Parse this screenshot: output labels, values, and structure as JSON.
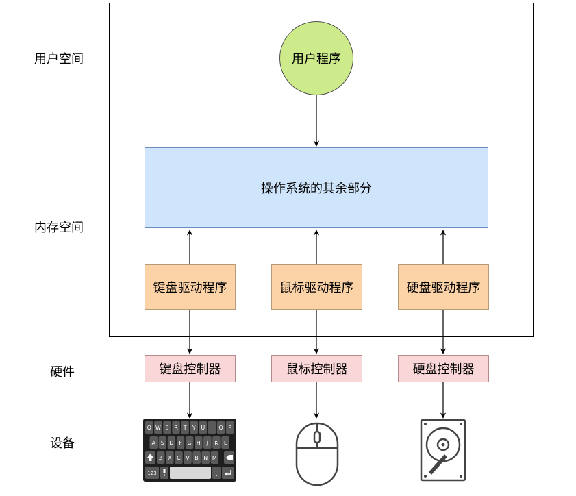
{
  "layers": {
    "user_space": "用户空间",
    "memory_space": "内存空间",
    "hardware": "硬件",
    "devices": "设备"
  },
  "user_program": "用户程序",
  "os_rest": "操作系统的其余部分",
  "drivers": {
    "keyboard": "键盘驱动程序",
    "mouse": "鼠标驱动程序",
    "disk": "硬盘驱动程序"
  },
  "controllers": {
    "keyboard": "键盘控制器",
    "mouse": "鼠标控制器",
    "disk": "硬盘控制器"
  },
  "keyboard_keys": {
    "row1": [
      "Q",
      "W",
      "E",
      "R",
      "T",
      "Y",
      "U",
      "I",
      "O",
      "P"
    ],
    "row2": [
      "A",
      "S",
      "D",
      "F",
      "G",
      "H",
      "J",
      "K",
      "L"
    ],
    "row3": [
      "Z",
      "X",
      "C",
      "V",
      "B",
      "N",
      "M"
    ],
    "num_key": "123"
  },
  "colors": {
    "user_program_fill": "#cdeb8b",
    "os_fill": "#cfe5fb",
    "driver_fill": "#fcd2a7",
    "controller_fill": "#f9d7d8"
  },
  "icons": [
    "keyboard-icon",
    "mouse-icon",
    "hard-disk-icon"
  ]
}
